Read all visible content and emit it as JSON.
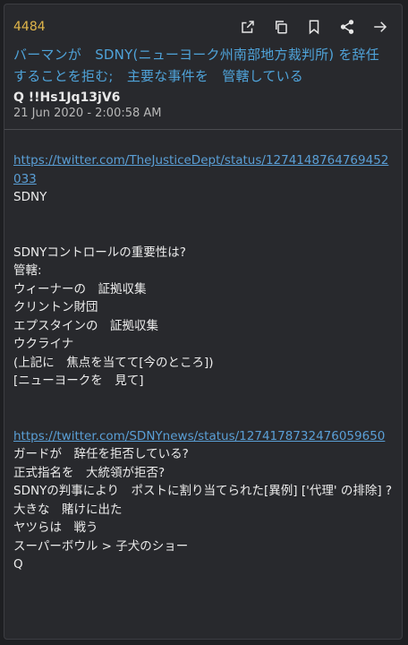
{
  "post": {
    "number": "4484",
    "title": "バーマンが　SDNY(ニューヨーク州南部地方裁判所) を辞任することを拒む;　主要な事件を　管轄している",
    "author": "Q  !!Hs1Jq13jV6",
    "timestamp": "21 Jun 2020 - 2:00:58 AM"
  },
  "toolbar": {
    "icons": [
      "open-external-icon",
      "copy-icon",
      "bookmark-icon",
      "share-icon",
      "forward-icon"
    ]
  },
  "body": {
    "link1": "https://twitter.com/TheJusticeDept/status/1274148764769452033",
    "line1": "SDNY",
    "line2": "SDNYコントロールの重要性は?",
    "line3": "管轄:",
    "line4": "ウィーナーの　証拠収集",
    "line5": "クリントン財団",
    "line6": "エプスタインの　証拠収集",
    "line7": "ウクライナ",
    "line8": "(上記に　焦点を当てて[今のところ])",
    "line9": "[ニューヨークを　見て]",
    "link2": "https://twitter.com/SDNYnews/status/1274178732476059650",
    "line10": "ガードが　辞任を拒否している?",
    "line11": "正式指名を　大統領が拒否?",
    "line12": "SDNYの判事により　ポストに割り当てられた[異例] ['代理' の排除] ?",
    "line13": "大きな　賭けに出た",
    "line14": "ヤツらは　戦う",
    "line15": "スーパーボウル > 子犬のショー",
    "line16": "Q"
  },
  "colors": {
    "background": "#28292d",
    "post_number": "#e0b64a",
    "title": "#4fa3d9",
    "link": "#5a9fd6"
  }
}
